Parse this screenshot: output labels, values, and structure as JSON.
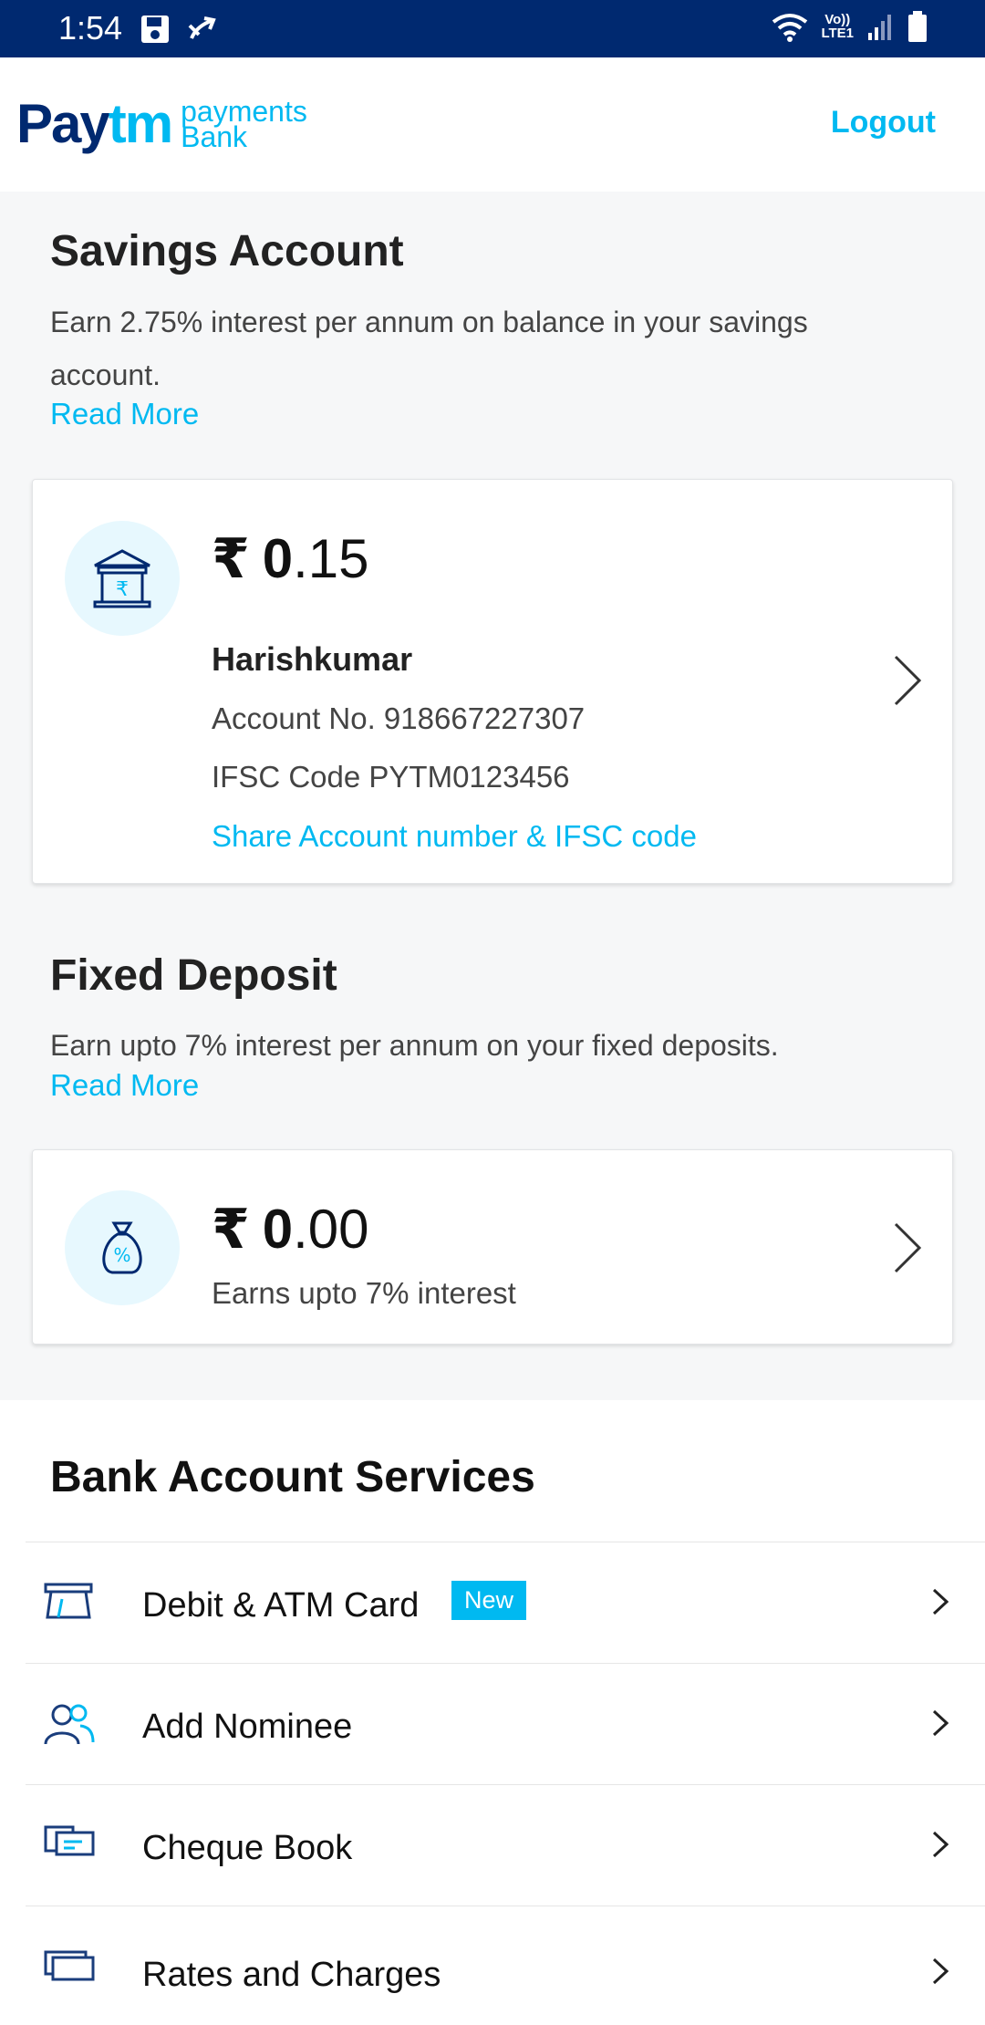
{
  "status_bar": {
    "time": "1:54",
    "volte_top": "Vo))",
    "volte_bottom": "LTE1"
  },
  "header": {
    "logo_main": "Pay",
    "logo_tm": "tm",
    "logo_sub_line1": "payments",
    "logo_sub_line2": "Bank",
    "logout_label": "Logout"
  },
  "savings": {
    "title": "Savings Account",
    "desc": "Earn 2.75% interest per annum on balance in your savings account.",
    "read_more": "Read More",
    "currency": "₹",
    "amount_int": "0",
    "amount_dec": ".15",
    "holder": "Harishkumar",
    "account_no": "Account No. 918667227307",
    "ifsc": "IFSC Code PYTM0123456",
    "share_link": "Share Account number & IFSC code"
  },
  "fixed_deposit": {
    "title": "Fixed Deposit",
    "desc": "Earn upto 7% interest per annum on your fixed deposits.",
    "read_more": "Read More",
    "currency": "₹",
    "amount_int": "0",
    "amount_dec": ".00",
    "note": "Earns upto 7% interest"
  },
  "services": {
    "title": "Bank Account Services",
    "items": [
      {
        "label": "Debit & ATM Card",
        "badge": "New",
        "icon": "atm-card-icon"
      },
      {
        "label": "Add Nominee",
        "icon": "nominee-icon"
      },
      {
        "label": "Cheque Book",
        "icon": "cheque-book-icon"
      },
      {
        "label": "Rates and Charges",
        "icon": "rates-card-icon"
      }
    ]
  },
  "colors": {
    "status_bar": "#002970",
    "brand_blue": "#00b9f1",
    "section_bg": "#f6f7f8"
  }
}
